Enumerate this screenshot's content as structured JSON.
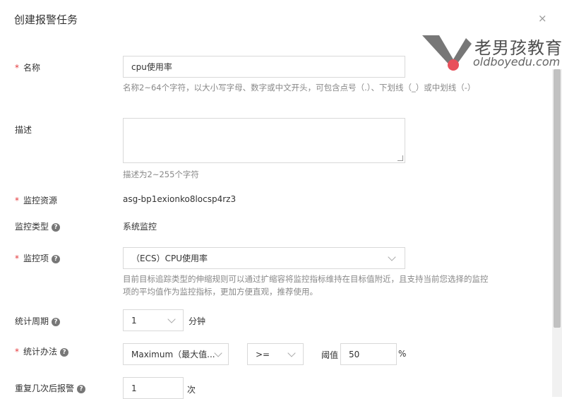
{
  "dialog": {
    "title": "创建报警任务",
    "close": "×"
  },
  "watermark": {
    "brand": "老男孩教育",
    "url": "oldboyedu.com"
  },
  "form": {
    "name": {
      "label": "名称",
      "value": "cpu使用率",
      "hint": "名称2~64个字符，以大小写字母、数字或中文开头，可包含点号（.）、下划线（_）或中划线（-）"
    },
    "description": {
      "label": "描述",
      "value": "",
      "hint": "描述为2~255个字符"
    },
    "resource": {
      "label": "监控资源",
      "value": "asg-bp1exionko8locsp4rz3"
    },
    "monitor_type": {
      "label": "监控类型",
      "value": "系统监控"
    },
    "monitor_item": {
      "label": "监控项",
      "selected": "（ECS）CPU使用率",
      "hint": "目前目标追踪类型的伸缩规则可以通过扩缩容将监控指标维持在目标值附近，且支持当前您选择的监控项的平均值作为监控指标，更加方便直观，推荐使用。"
    },
    "period": {
      "label": "统计周期",
      "selected": "1",
      "unit": "分钟"
    },
    "method": {
      "label": "统计办法",
      "selected": "Maximum（最大值...",
      "operator": ">=",
      "threshold_label": "阈值",
      "threshold": "50",
      "unit": "%"
    },
    "repeat": {
      "label": "重复几次后报警",
      "value": "1",
      "unit": "次"
    }
  },
  "colors": {
    "required": "#e4393c",
    "border": "#d9d9d9",
    "watermark_dot": "#e8505b"
  },
  "icons": [
    "help-icon",
    "chevron-down-icon",
    "close-icon",
    "resize-handle-icon"
  ]
}
